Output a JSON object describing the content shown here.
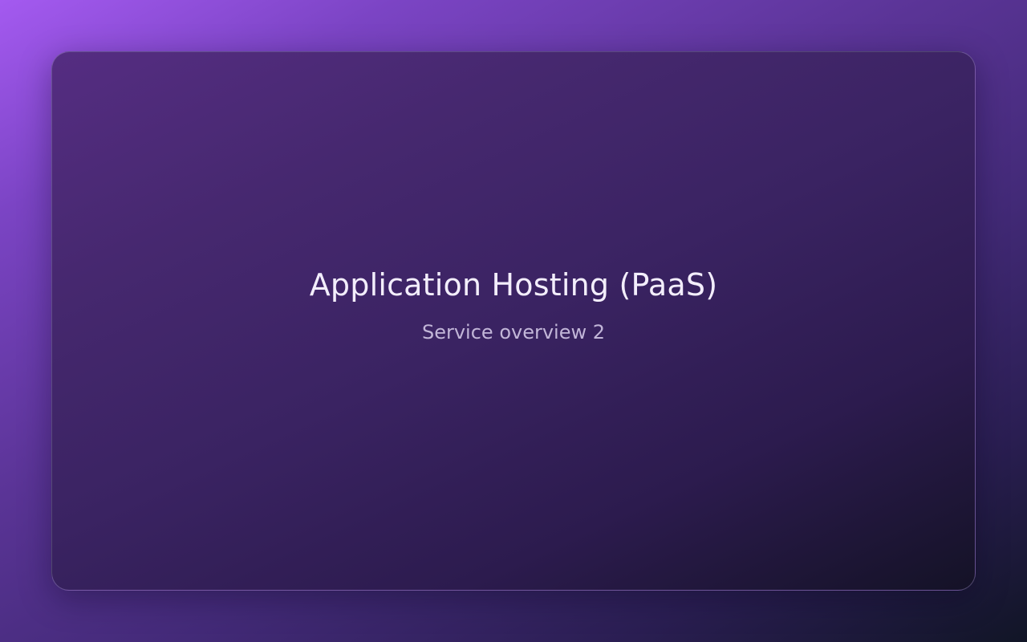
{
  "slide": {
    "title": "Application Hosting (PaaS)",
    "subtitle": "Service overview 2"
  },
  "colors": {
    "background_start": "#a45af0",
    "background_end": "#111526",
    "card_start": "#552d82",
    "card_end": "#141226",
    "title_text": "#f3eefc",
    "subtitle_text": "#c2b6d8"
  }
}
